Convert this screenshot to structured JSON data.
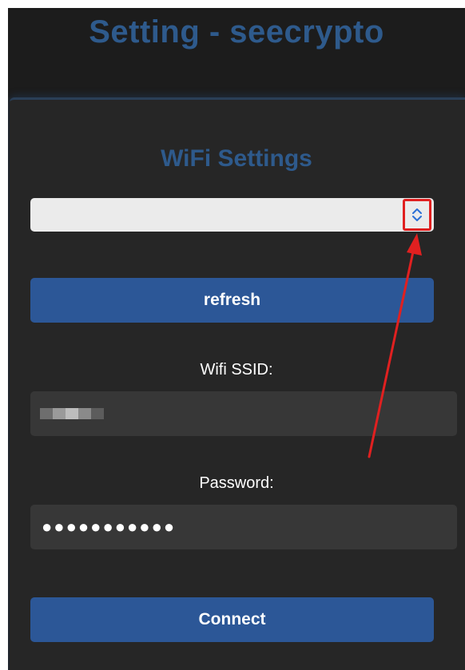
{
  "header": {
    "title": "Setting - seecrypto"
  },
  "wifi": {
    "section_title": "WiFi Settings",
    "network_select": {
      "selected_value": ""
    },
    "refresh_label": "refresh",
    "ssid": {
      "label": "Wifi SSID:"
    },
    "password": {
      "label": "Password:",
      "masked_value": "●●●●●●●●●●●"
    },
    "connect_label": "Connect"
  },
  "colors": {
    "accent_blue": "#2c5797",
    "title_blue": "#2e5a8c",
    "annotation_red": "#e02020"
  },
  "icons": {
    "select_toggle": "chevron-up-down-icon",
    "annotation": "arrow-up-icon"
  }
}
